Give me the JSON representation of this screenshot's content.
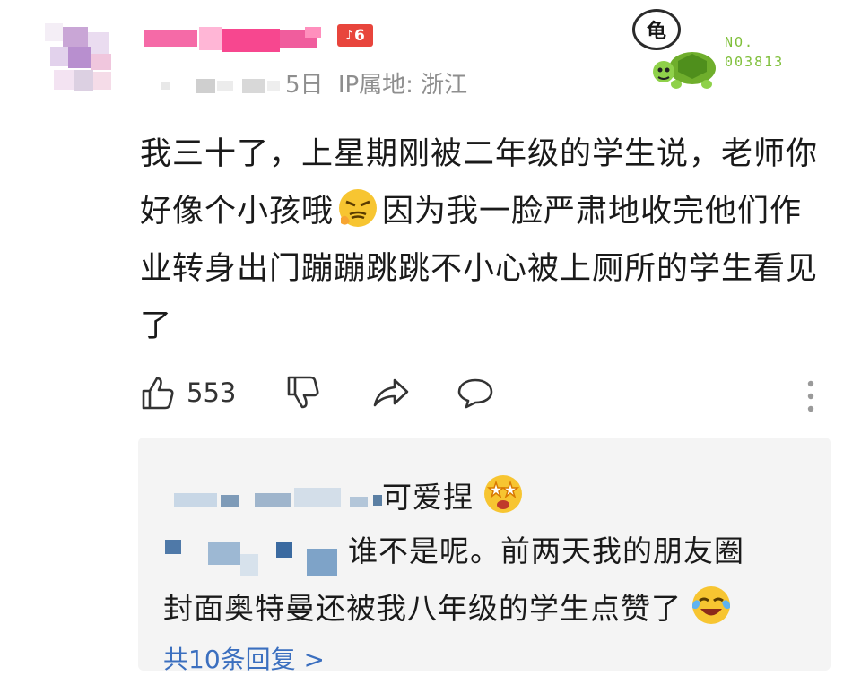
{
  "comment": {
    "level_badge": "6",
    "date_partial": "5日",
    "ip_location": "IP属地: 浙江",
    "text_parts": [
      "我三十了，上星期刚被二年级的学生说，老师你好像个小孩哦",
      "因为我一脸严肃地收完他们作业转身出门蹦蹦跳跳不小心被上厕所的学生看见了"
    ],
    "emoji_1": "smirk-emoji",
    "like_count": "553"
  },
  "badge": {
    "bubble_char": "龟",
    "number_label": "NO.",
    "number": "003813"
  },
  "replies": [
    {
      "text": "可爱捏",
      "emoji": "starry-eyes-emoji"
    },
    {
      "line1": "谁不是呢。前两天我的朋友圈",
      "line2": "封面奥特曼还被我八年级的学生点赞了",
      "emoji": "tears-of-joy-emoji"
    }
  ],
  "more_replies_label": "共10条回复 >",
  "colors": {
    "accent_red": "#e8453c",
    "badge_green": "#7fbf3a",
    "reply_bg": "#f4f4f4",
    "meta_gray": "#8e8e8e"
  }
}
